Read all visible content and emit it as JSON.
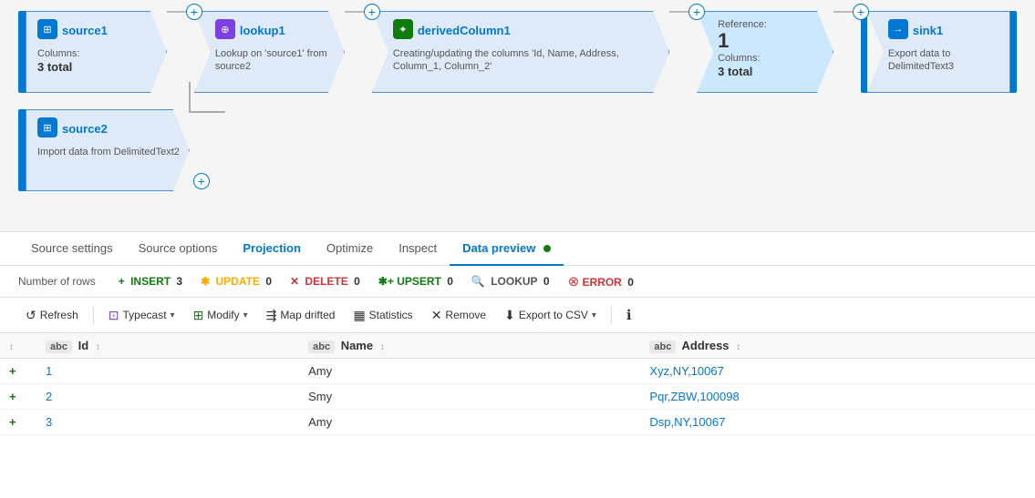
{
  "pipeline": {
    "nodes": [
      {
        "id": "source1",
        "title": "source1",
        "icon": "table-icon",
        "icon_char": "⊞",
        "icon_color": "#0078d4",
        "desc_label": "Columns:",
        "desc_value": "3 total",
        "type": "first"
      },
      {
        "id": "lookup1",
        "title": "lookup1",
        "icon": "lookup-icon",
        "icon_char": "⊕",
        "icon_color": "#7b3fe4",
        "desc_text": "Lookup on 'source1' from source2",
        "type": "middle"
      },
      {
        "id": "derivedColumn1",
        "title": "derivedColumn1",
        "icon": "derived-icon",
        "icon_char": "✦",
        "icon_color": "#107c10",
        "desc_text": "Creating/updating the columns 'Id, Name, Address, Column_1, Column_2'",
        "type": "middle"
      },
      {
        "id": "reference",
        "title": "",
        "reference_label": "Reference:",
        "reference_value": "1",
        "desc_label": "Columns:",
        "desc_value": "3 total",
        "icon": "ref-icon",
        "icon_char": "",
        "type": "reference"
      },
      {
        "id": "sink1",
        "title": "sink1",
        "icon": "sink-icon",
        "icon_char": "→",
        "icon_color": "#0078d4",
        "desc_text": "Export data to DelimitedText3",
        "type": "last"
      }
    ],
    "source2": {
      "title": "source2",
      "icon": "table-icon",
      "icon_char": "⊞",
      "icon_color": "#0078d4",
      "desc_text": "Import data from DelimitedText2"
    }
  },
  "tabs": [
    {
      "label": "Source settings",
      "active": false
    },
    {
      "label": "Source options",
      "active": false
    },
    {
      "label": "Projection",
      "active": false
    },
    {
      "label": "Optimize",
      "active": false
    },
    {
      "label": "Inspect",
      "active": false
    },
    {
      "label": "Data preview",
      "active": true
    }
  ],
  "stats": {
    "rows_label": "Number of rows",
    "insert_label": "INSERT",
    "insert_value": "3",
    "update_label": "UPDATE",
    "update_value": "0",
    "delete_label": "DELETE",
    "delete_value": "0",
    "upsert_label": "UPSERT",
    "upsert_value": "0",
    "lookup_label": "LOOKUP",
    "lookup_value": "0",
    "error_label": "ERROR",
    "error_value": "0"
  },
  "toolbar": {
    "refresh_label": "Refresh",
    "typecast_label": "Typecast",
    "modify_label": "Modify",
    "map_drifted_label": "Map drifted",
    "statistics_label": "Statistics",
    "remove_label": "Remove",
    "export_label": "Export to CSV",
    "info_icon": "ℹ"
  },
  "table": {
    "columns": [
      {
        "name": "Id",
        "type": "abc",
        "sortable": true
      },
      {
        "name": "Name",
        "type": "abc",
        "sortable": true
      },
      {
        "name": "Address",
        "type": "abc",
        "sortable": true
      }
    ],
    "rows": [
      {
        "id": "1",
        "name": "Amy",
        "address": "Xyz,NY,10067"
      },
      {
        "id": "2",
        "name": "Smy",
        "address": "Pqr,ZBW,100098"
      },
      {
        "id": "3",
        "name": "Amy",
        "address": "Dsp,NY,10067"
      }
    ]
  }
}
